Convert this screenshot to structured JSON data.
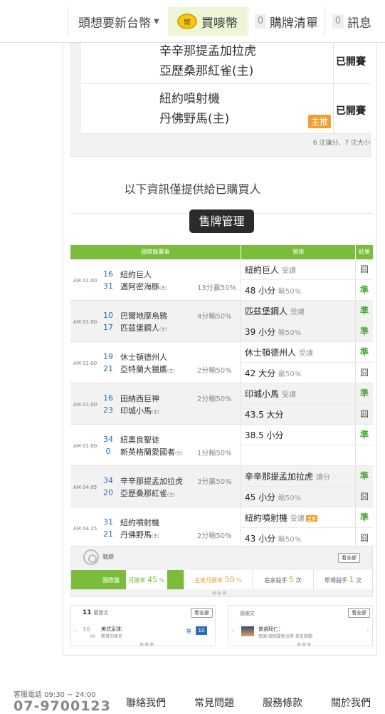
{
  "topbar": {
    "user_name": "頭想要新台幣",
    "coin_icon_text": "幣",
    "buy_coin": "買嘜幣",
    "cart_count": "0",
    "cart_label": "購牌清單",
    "msg_count": "0",
    "msg_label": "訊息"
  },
  "previous": {
    "rows": [
      {
        "team1": "辛辛那提孟加拉虎",
        "team2": "亞歷桑那紅雀(主)",
        "status": "已開賽",
        "tag": ""
      },
      {
        "team1": "紐約噴射機",
        "team2": "丹佛野馬(主)",
        "status": "已開賽",
        "tag": "主推"
      }
    ],
    "note": "6 注讓分、7 注大小"
  },
  "buyer_note": "以下資訊僅提供給已購買人",
  "sell_button": "售牌管理",
  "table": {
    "headers": {
      "event": "國際盤賽事",
      "pred": "預測",
      "result": "結果"
    },
    "games": [
      {
        "time": "AM 01:00",
        "n1": "16",
        "t1": "紐約巨人",
        "n2": "31",
        "t2": "邁阿密海豚",
        "home": "(主)",
        "line": "13分贏50%",
        "line_row": 2,
        "p1": "紐約巨人",
        "p1s": "受讓",
        "r1": "囧",
        "p2": "48 小分",
        "p2s": "輸50%",
        "r2": "準"
      },
      {
        "time": "AM 01:00",
        "n1": "10",
        "t1": "巴爾地摩烏鴉",
        "n2": "17",
        "t2": "匹茲堡鋼人",
        "home": "(主)",
        "line": "4分輸50%",
        "line_row": 1,
        "p1": "匹茲堡鋼人",
        "p1s": "受讓",
        "r1": "準",
        "p2": "39 小分",
        "p2s": "輸50%",
        "r2": "準"
      },
      {
        "time": "AM 01:00",
        "n1": "19",
        "t1": "休士頓德州人",
        "n2": "21",
        "t2": "亞特蘭大獵鷹",
        "home": "(主)",
        "line": "2分輸50%",
        "line_row": 2,
        "p1": "休士頓德州人",
        "p1s": "受讓",
        "r1": "準",
        "p2": "42 大分",
        "p2s": "贏50%",
        "r2": "囧"
      },
      {
        "time": "AM 01:00",
        "n1": "16",
        "t1": "田納西巨神",
        "n2": "23",
        "t2": "印城小馬",
        "home": "(主)",
        "line": "2分輸50%",
        "line_row": 1,
        "p1": "印城小馬",
        "p1s": "受讓",
        "r1": "準",
        "p2": "43.5 大分",
        "p2s": "",
        "r2": "囧"
      },
      {
        "time": "AM 01:00",
        "n1": "34",
        "t1": "紐奧良聖徒",
        "n2": "0",
        "t2": "新英格蘭愛國者",
        "home": "(主)",
        "line": "1分輸50%",
        "line_row": 2,
        "p1": "38.5 小分",
        "p1s": "",
        "r1": "準",
        "p2": "",
        "p2s": "",
        "r2": ""
      },
      {
        "time": "AM 04:05",
        "n1": "34",
        "t1": "辛辛那提孟加拉虎",
        "n2": "20",
        "t2": "亞歷桑那紅雀",
        "home": "(主)",
        "line": "3分贏50%",
        "line_row": 1,
        "p1": "辛辛那提孟加拉虎",
        "p1s": "讓分",
        "r1": "準",
        "p2": "45 小分",
        "p2s": "輸50%",
        "r2": "囧"
      },
      {
        "time": "AM 04:25",
        "n1": "31",
        "t1": "紐約噴射機",
        "n2": "21",
        "t2": "丹佛野馬",
        "home": "(主)",
        "line": "2分輸50%",
        "line_row": 2,
        "p1": "紐約噴射機",
        "p1s": "受讓",
        "p1tag": "主推",
        "r1": "準",
        "p2": "43 小分",
        "p2s": "輸50%",
        "r2": "囧"
      }
    ]
  },
  "record": {
    "title": "戰績",
    "view_all": "看全部",
    "tabs": [
      {
        "label": "國際盤",
        "value": ""
      },
      {
        "label": "月勝率",
        "value": "45",
        "unit": "%"
      },
      {
        "label": "主推月勝率",
        "value": "50",
        "unit": "%"
      },
      {
        "label": "莊家殺手",
        "value": "5",
        "unit": "次"
      },
      {
        "label": "單場殺手",
        "value": "1",
        "unit": "次"
      }
    ]
  },
  "cards": {
    "posts": {
      "count": "11",
      "label": "篇發文",
      "view_all": "看全部",
      "day": "10",
      "month": "08",
      "title": "美式足球：",
      "sub": "勝哥的美足",
      "badge1": "推",
      "badge2": "10"
    },
    "thanks": {
      "label": "感謝文",
      "view_all": "看全部",
      "author": "普選拜仁：",
      "text": "感謝 頭想要新台幣 美足串關"
    }
  },
  "footer": {
    "service_hours": "客服電話 09:30 ~ 24:00",
    "phone": "07-9700123",
    "links": [
      "聯絡我們",
      "常見問題",
      "服務條款",
      "關於我們"
    ]
  },
  "colors": {
    "green": "#7bbd3a",
    "orange": "#f0a030",
    "blue": "#2a6fb5",
    "dark_button": "#2b2b2b"
  }
}
